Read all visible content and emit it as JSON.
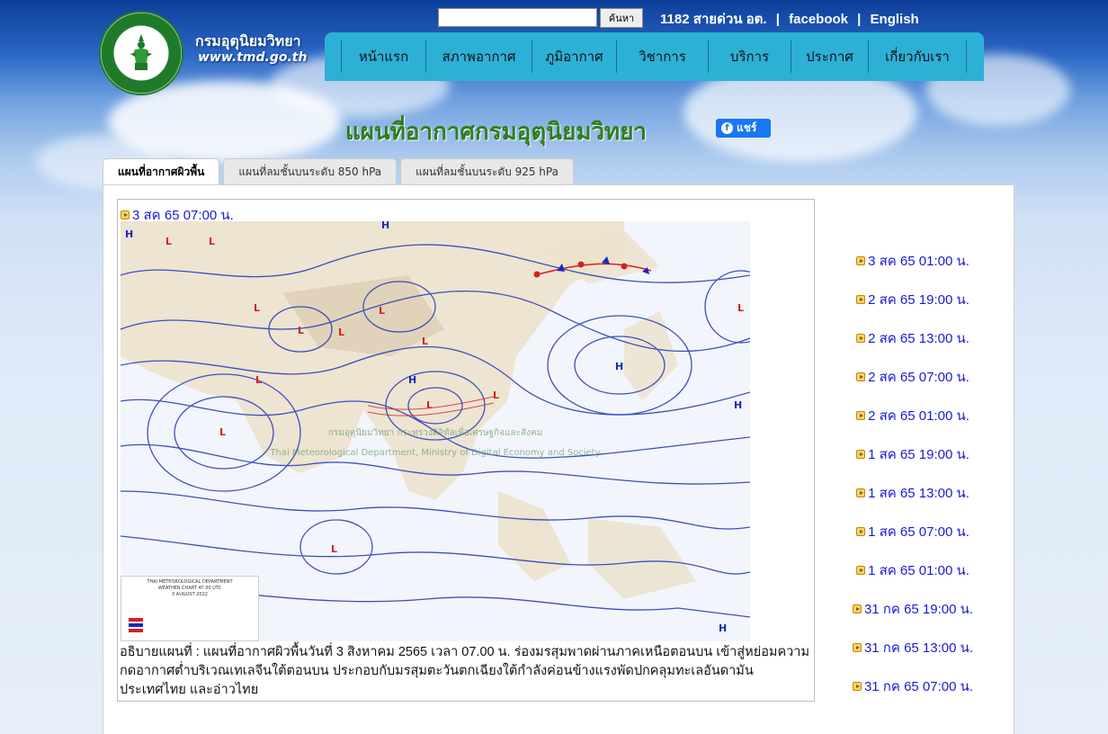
{
  "header": {
    "site_name": "กรมอุตุนิยมวิทยา",
    "site_url": "www.tmd.go.th",
    "search_button": "ค้นหา",
    "hotline": "1182 สายด่วน อต.",
    "separator": "|",
    "facebook": "facebook",
    "english": "English"
  },
  "nav": {
    "items": [
      {
        "label": "หน้าแรก"
      },
      {
        "label": "สภาพอากาศ"
      },
      {
        "label": "ภูมิอากาศ"
      },
      {
        "label": "วิชาการ"
      },
      {
        "label": "บริการ"
      },
      {
        "label": "ประกาศ"
      },
      {
        "label": "เกี่ยวกับเรา"
      }
    ]
  },
  "page": {
    "title": "แผนที่อากาศกรมอุตุนิยมวิทยา",
    "share_label": "แชร์"
  },
  "tabs": [
    {
      "label": "แผนที่อากาศผิวพื้น",
      "active": true
    },
    {
      "label": "แผนที่ลมชั้นบนระดับ 850 hPa",
      "active": false
    },
    {
      "label": "แผนที่ลมชั้นบนระดับ 925 hPa",
      "active": false
    }
  ],
  "map": {
    "date_label": "3 สค 65 07:00 น.",
    "legend_line1": "THAI METEOROLOGICAL DEPARTMENT",
    "legend_line2": "WEATHER CHART AT 00 UTC",
    "legend_line3": "3 AUGUST 2022",
    "watermark_line1": "กรมอุตุนิยมวิทยา กระทรวงดิจิทัลเพื่อเศรษฐกิจและสังคม",
    "watermark_line2": "Thai Meteorological Department, Ministry of Digital Economy and Society",
    "description": "อธิบายแผนที่ : แผนที่อากาศผิวพื้นวันที่ 3 สิงหาคม 2565 เวลา 07.00 น. ร่องมรสุมพาดผ่านภาคเหนือตอนบน เข้าสู่หย่อมความกดอากาศต่ำบริเวณเทเลจีนใต้ตอนบน ประกอบกับมรสุมตะวันตกเฉียงใต้กำลังค่อนข้างแรงพัดปกคลุมทะเลอันดามัน ประเทศไทย และอ่าวไทย"
  },
  "side_list": [
    {
      "label": "3 สค 65 01:00 น."
    },
    {
      "label": "2 สค 65 19:00 น."
    },
    {
      "label": "2 สค 65 13:00 น."
    },
    {
      "label": "2 สค 65 07:00 น."
    },
    {
      "label": "2 สค 65 01:00 น."
    },
    {
      "label": "1 สค 65 19:00 น."
    },
    {
      "label": "1 สค 65 13:00 น."
    },
    {
      "label": "1 สค 65 07:00 น."
    },
    {
      "label": "1 สค 65 01:00 น."
    },
    {
      "label": "31 กค 65 19:00 น."
    },
    {
      "label": "31 กค 65 13:00 น."
    },
    {
      "label": "31 กค 65 07:00 น."
    }
  ],
  "colors": {
    "nav_bg": "#2db0d6",
    "title_green": "#2e7d1e",
    "link_blue": "#1a1ad6",
    "isobar_blue": "#2a3fb8",
    "low_red": "#d42020",
    "high_blue": "#1a2ab8"
  }
}
